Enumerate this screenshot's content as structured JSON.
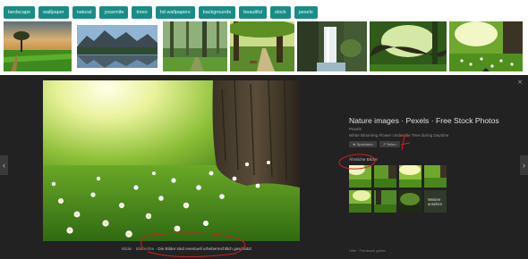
{
  "chips": [
    "landscape",
    "wallpaper",
    "natural",
    "yosemite",
    "trees",
    "hd wallpapers",
    "backgrounds",
    "beautiful",
    "stock",
    "pexels"
  ],
  "colors": {
    "chip_bg": "#1a8c87",
    "panel_bg": "#222222",
    "annotation": "#d11f1f"
  },
  "viewer": {
    "close_icon": "×",
    "prev_icon": "‹",
    "next_icon": "›",
    "footer_left": "Bilder · Bildrechte",
    "footer_right": "Die Bilder sind eventuell urheberrechtlich geschützt",
    "title": "Nature images · Pexels · Free Stock Photos",
    "source": "Pexels",
    "description": "White Blooming Flower Under the Tree during Daytime",
    "save_label": "Speichern",
    "share_label": "Teilen",
    "similar_label": "Ähnliche Bilder",
    "more_label": "Weitere ansehen",
    "bottom_links": "Hilfe · Feedback geben"
  }
}
